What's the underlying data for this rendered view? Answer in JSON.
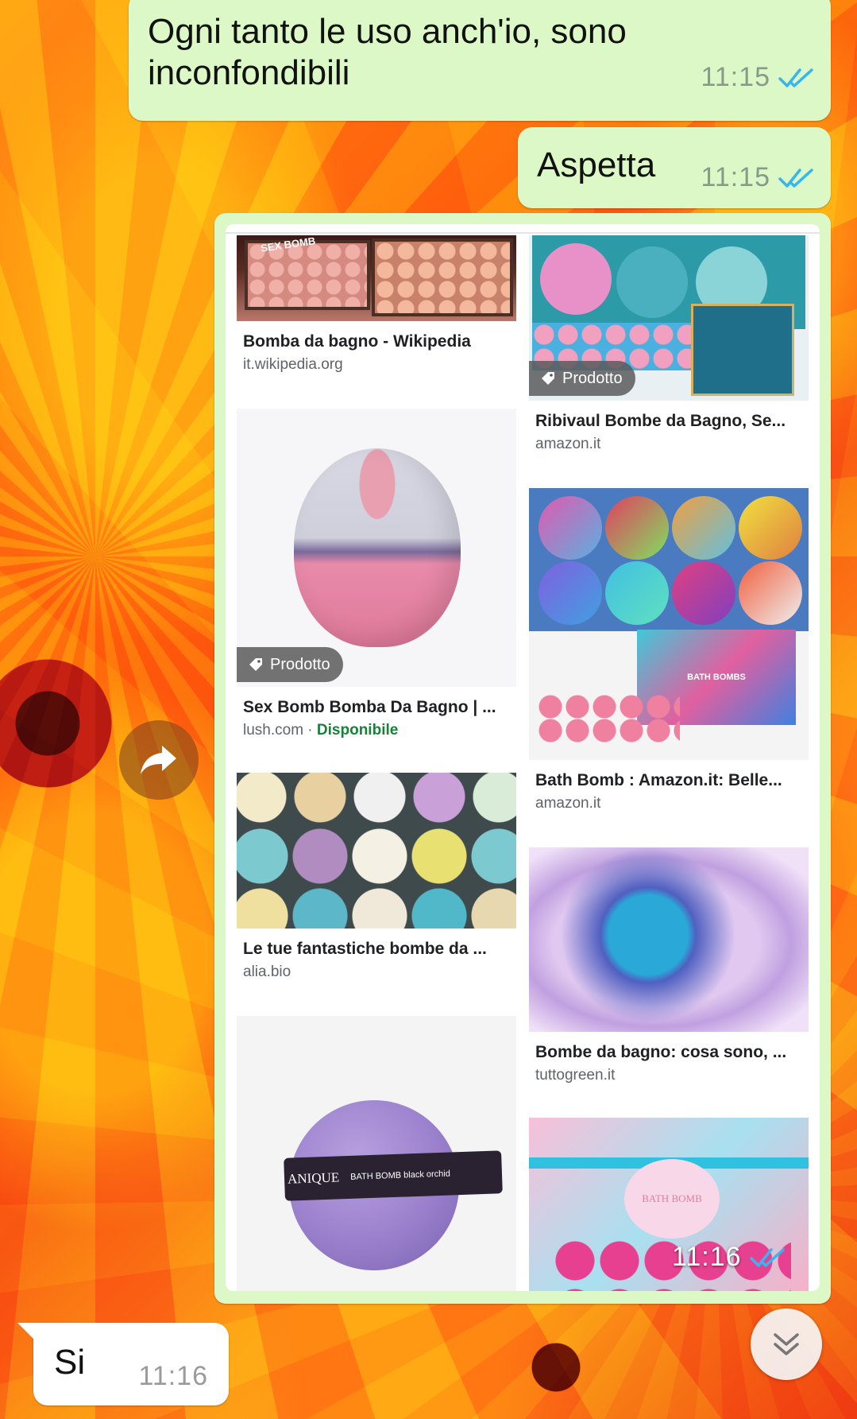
{
  "messages": [
    {
      "text": "Ogni tanto le uso anch'io, sono inconfondibili",
      "time": "11:15",
      "status": "read"
    },
    {
      "text": "Aspetta",
      "time": "11:15",
      "status": "read"
    },
    {
      "time": "11:16",
      "status": "read"
    },
    {
      "text": "Si",
      "time": "11:16"
    }
  ],
  "screenshot": {
    "left_column": [
      {
        "title": "Bomba da bagno - Wikipedia",
        "source": "it.wikipedia.org"
      },
      {
        "title": "Sex Bomb Bomba Da Bagno | ...",
        "source": "lush.com",
        "availability": "Disponibile",
        "badge": "Prodotto"
      },
      {
        "title": "Le tue fantastiche bombe da ...",
        "source": "alia.bio"
      },
      {
        "image_text_1": "ANIQUE",
        "image_text_2": "BATH BOMB black orchid"
      }
    ],
    "right_column": [
      {
        "title": "Ribivaul Bombe da Bagno, Se...",
        "source": "amazon.it",
        "badge": "Prodotto"
      },
      {
        "title": "Bath Bomb : Amazon.it: Belle...",
        "source": "amazon.it",
        "image_text": "BATH BOMBS"
      },
      {
        "title": "Bombe da bagno: cosa sono, ...",
        "source": "tuttogreen.it"
      },
      {
        "image_text": "BATH BOMB"
      }
    ],
    "wikipedia_image_text": "SEX BOMB",
    "source_separator": " · "
  },
  "colors": {
    "outgoing_bubble": "#dcf8c6",
    "incoming_bubble": "#ffffff",
    "read_ticks": "#34b7f1",
    "available_green": "#188038"
  },
  "icons": {
    "forward": "forward-arrow-icon",
    "scroll_down": "double-chevron-down-icon",
    "tag": "tag-icon"
  }
}
